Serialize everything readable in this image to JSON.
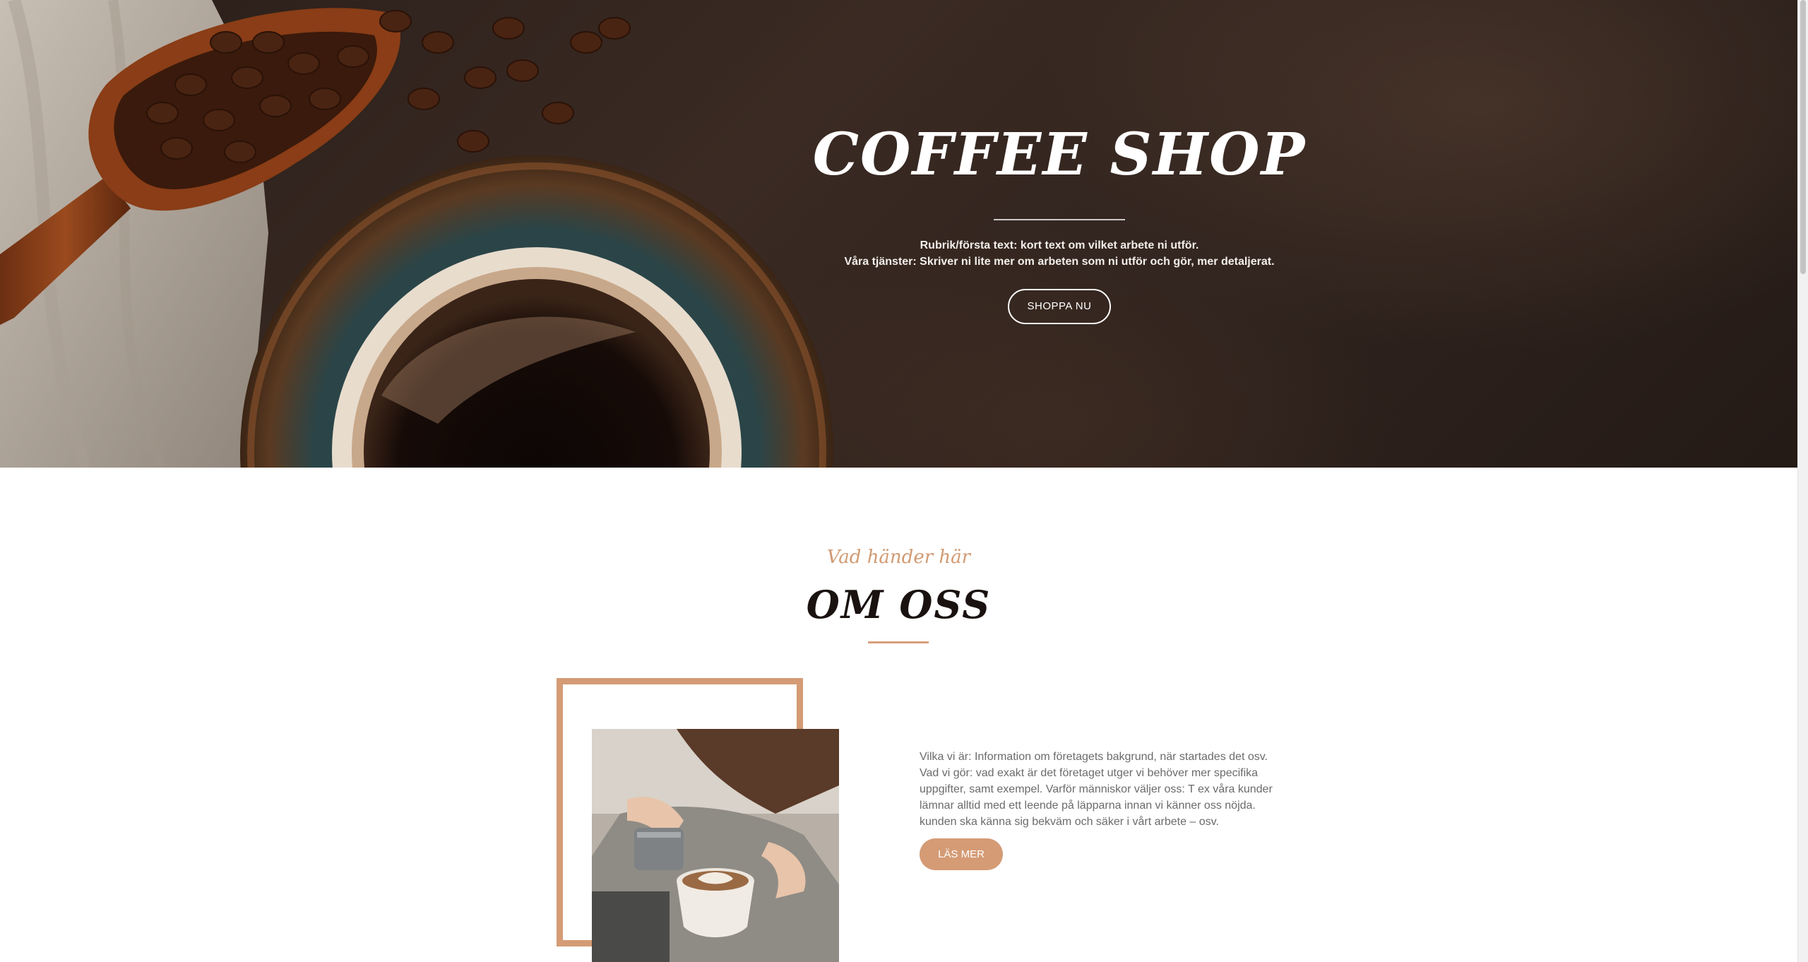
{
  "hero": {
    "title": "COFFEE SHOP",
    "line1": "Rubrik/första text: kort text om vilket arbete ni utför.",
    "line2": "Våra tjänster: Skriver ni lite mer om arbeten som ni utför och gör, mer detaljerat.",
    "button_label": "SHOPPA NU",
    "image": "coffee-cup-and-beans-photo"
  },
  "about": {
    "kicker": "Vad händer här",
    "title": "OM OSS",
    "paragraph": "Vilka vi är: Information om företagets bakgrund, när startades det osv. Vad vi gör: vad exakt är det företaget utger vi behöver mer specifika uppgifter, samt exempel. Varför människor väljer oss: T ex våra kunder lämnar alltid med ett leende på läpparna innan vi känner oss nöjda. kunden ska känna sig bekväm och säker i vårt arbete – osv.",
    "button_label": "LÄS MER",
    "image": "barista-latte-art-photo"
  },
  "colors": {
    "accent": "#d49b75",
    "hero_bg": "#2e221d",
    "heading": "#1a1210",
    "body_text": "#6b6b6b"
  }
}
